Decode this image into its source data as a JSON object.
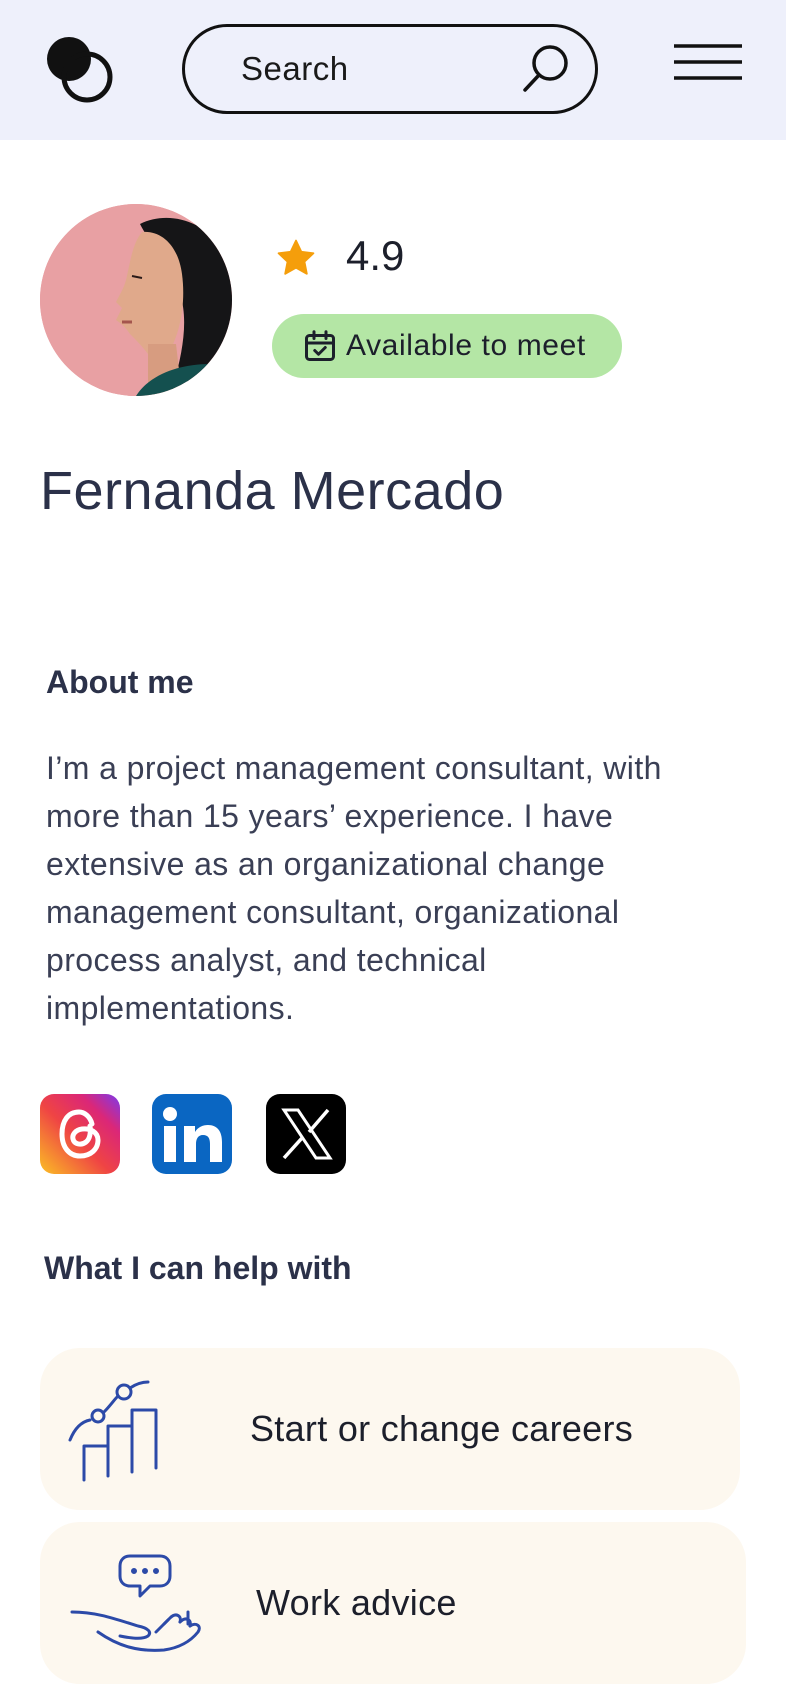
{
  "header": {
    "search": {
      "placeholder": "Search"
    }
  },
  "profile": {
    "rating": "4.9",
    "availability": "Available to meet",
    "name": "Fernanda Mercado"
  },
  "about": {
    "heading": "About me",
    "text": "I’m a project management consultant, with more than 15 years’ experience. I have extensive as an organizational change management consultant, organizational process analyst, and technical implementations."
  },
  "social": {
    "icons": [
      "threads-icon",
      "linkedin-icon",
      "x-icon"
    ],
    "linkedin_text": "in"
  },
  "help": {
    "heading": "What I can help with",
    "items": [
      {
        "label": "Start or change careers",
        "icon": "career-steps-icon"
      },
      {
        "label": "Work advice",
        "icon": "hand-chat-icon"
      }
    ]
  },
  "colors": {
    "header_bg": "#eef0fb",
    "badge_bg": "#b4e6a5",
    "star": "#f59e0b",
    "card_bg": "#fdf8ef",
    "text_dark": "#2b3149",
    "icon_blue": "#2c4aa8"
  }
}
